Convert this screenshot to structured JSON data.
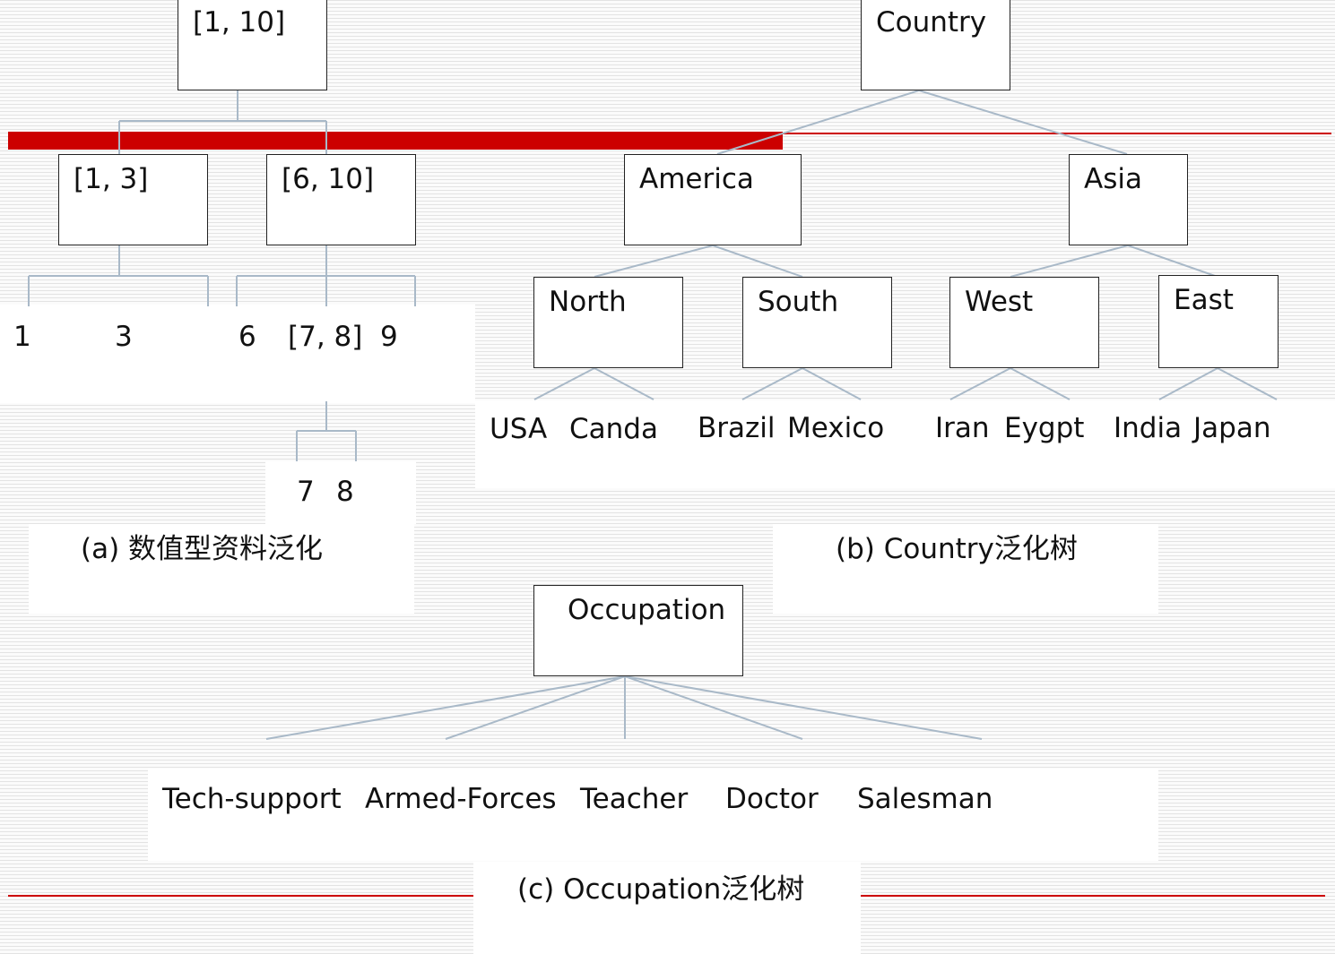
{
  "accent_color": "#cc0000",
  "edge_color": "#a9b9c8",
  "numeric_tree": {
    "root": "[1, 10]",
    "children": [
      "[1, 3]",
      "[6, 10]"
    ],
    "leaves_a": [
      "1",
      "3"
    ],
    "leaves_b": [
      "6",
      "[7, 8]",
      "9"
    ],
    "leaves_c": [
      "7",
      "8"
    ],
    "caption": "(a) 数值型资料泛化"
  },
  "country_tree": {
    "root": "Country",
    "regions": [
      "America",
      "Asia"
    ],
    "subregions": [
      "North",
      "South",
      "West",
      "East"
    ],
    "leaves": [
      "USA",
      "Canda",
      "Brazil",
      "Mexico",
      "Iran",
      "Eygpt",
      "India",
      "Japan"
    ],
    "caption": "(b) Country泛化树"
  },
  "occupation_tree": {
    "root": "Occupation",
    "leaves": [
      "Tech-support",
      "Armed-Forces",
      "Teacher",
      "Doctor",
      "Salesman"
    ],
    "caption": "(c) Occupation泛化树"
  }
}
